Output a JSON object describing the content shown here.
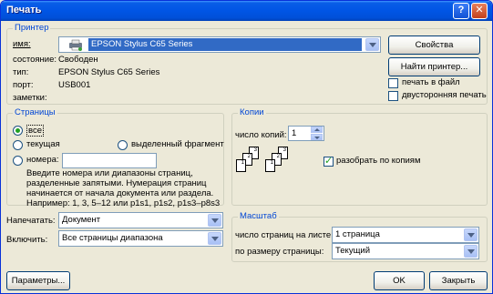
{
  "window": {
    "title": "Печать"
  },
  "printer": {
    "group_label": "Принтер",
    "name_label": "имя:",
    "name_value": "EPSON Stylus C65 Series",
    "status_label": "состояние:",
    "status_value": "Свободен",
    "type_label": "тип:",
    "type_value": "EPSON Stylus C65 Series",
    "port_label": "порт:",
    "port_value": "USB001",
    "comment_label": "заметки:",
    "properties_button": "Свойства",
    "find_button": "Найти принтер...",
    "print_to_file": "печать в файл",
    "duplex": "двусторонняя печать",
    "print_to_file_checked": false,
    "duplex_checked": false
  },
  "pages": {
    "group_label": "Страницы",
    "all": "все",
    "current": "текущая",
    "selection": "выделенный фрагмент",
    "numbers": "номера:",
    "hint": [
      "Введите номера или диапазоны страниц,",
      "разделенные запятыми. Нумерация страниц",
      "начинается от начала документа или раздела.",
      "Например: 1, 3, 5–12 или p1s1, p1s2, p1s3–p8s3"
    ],
    "selected": "all"
  },
  "copies": {
    "group_label": "Копии",
    "count_label": "число копий:",
    "count_value": "1",
    "collate_label": "разобрать по копиям",
    "collate_checked": true,
    "page_numbers": [
      "3",
      "2",
      "1"
    ]
  },
  "print_what": {
    "label": "Напечатать:",
    "value": "Документ"
  },
  "include": {
    "label": "Включить:",
    "value": "Все страницы диапазона"
  },
  "zoom": {
    "group_label": "Масштаб",
    "pages_per_sheet_label": "число страниц на листе:",
    "pages_per_sheet_value": "1 страница",
    "scale_label": "по размеру страницы:",
    "scale_value": "Текущий"
  },
  "buttons": {
    "options": "Параметры...",
    "ok": "OK",
    "close": "Закрыть"
  }
}
